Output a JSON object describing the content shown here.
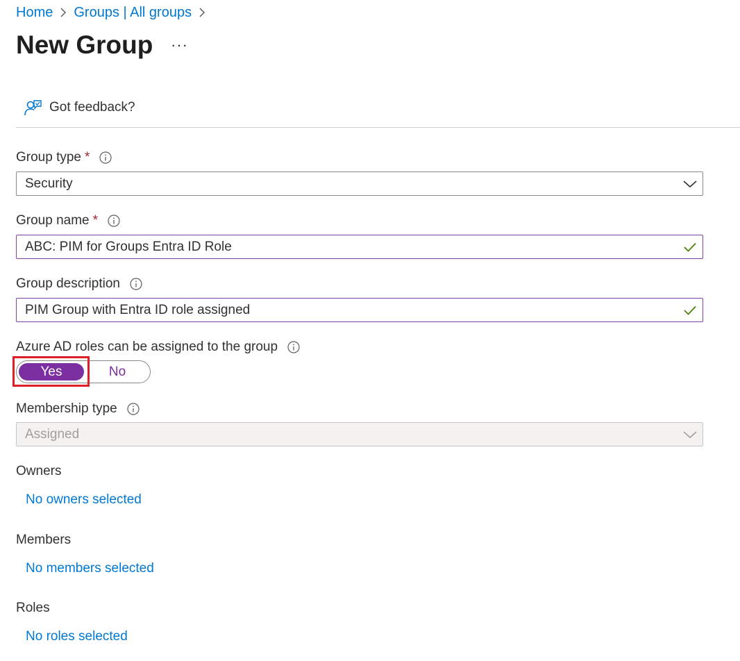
{
  "breadcrumb": [
    {
      "label": "Home"
    },
    {
      "label": "Groups | All groups"
    }
  ],
  "page_title": "New Group",
  "more_glyph": "···",
  "feedback": {
    "label": "Got feedback?",
    "icon": "feedback-person-icon"
  },
  "form": {
    "group_type": {
      "label": "Group type",
      "required_mark": "*",
      "value": "Security"
    },
    "group_name": {
      "label": "Group name",
      "required_mark": "*",
      "value": "ABC: PIM for Groups Entra ID Role"
    },
    "group_description": {
      "label": "Group description",
      "value": "PIM Group with Entra ID role assigned"
    },
    "azure_ad_roles": {
      "label": "Azure AD roles can be assigned to the group",
      "yes": "Yes",
      "no": "No",
      "selected": "Yes"
    },
    "membership_type": {
      "label": "Membership type",
      "value": "Assigned",
      "disabled": true
    },
    "owners": {
      "label": "Owners",
      "link": "No owners selected"
    },
    "members": {
      "label": "Members",
      "link": "No members selected"
    },
    "roles": {
      "label": "Roles",
      "link": "No roles selected"
    }
  },
  "colors": {
    "link": "#0078d4",
    "accent_purple": "#7b2fa0",
    "valid_check": "#498205",
    "highlight_red": "#e01e25",
    "required": "#a4262c"
  }
}
